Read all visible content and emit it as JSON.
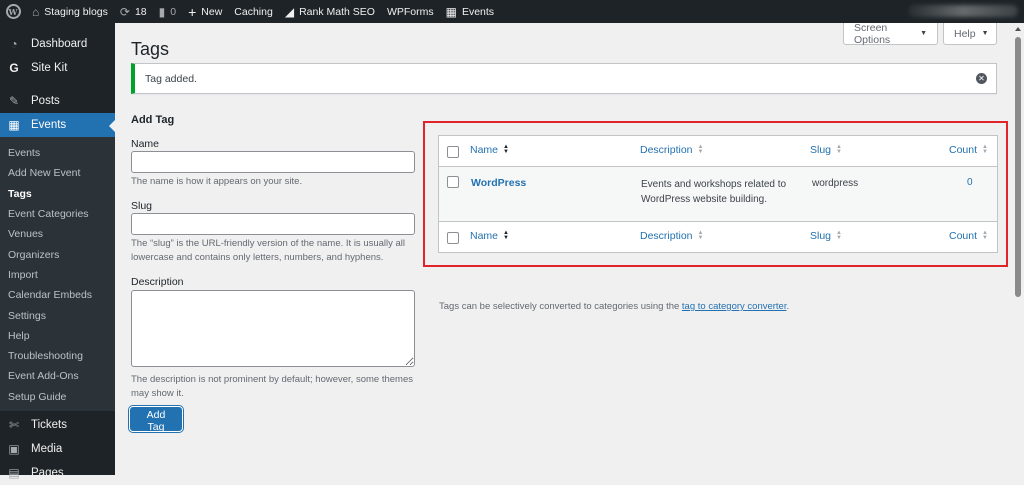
{
  "adminbar": {
    "site_name": "Staging blogs",
    "updates_count": "18",
    "comments_count": "0",
    "new_label": "New",
    "caching_label": "Caching",
    "rankmath_label": "Rank Math SEO",
    "wpforms_label": "WPForms",
    "events_label": "Events"
  },
  "sidebar": {
    "top_items": [
      {
        "label": "Dashboard",
        "icon": "dashboard-icon"
      },
      {
        "label": "Site Kit",
        "icon": "site-kit-icon"
      },
      {
        "label": "Posts",
        "icon": "pin-icon"
      },
      {
        "label": "Events",
        "icon": "calendar-icon"
      }
    ],
    "submenu": [
      "Events",
      "Add New Event",
      "Tags",
      "Event Categories",
      "Venues",
      "Organizers",
      "Import",
      "Calendar Embeds",
      "Settings",
      "Help",
      "Troubleshooting",
      "Event Add-Ons",
      "Setup Guide"
    ],
    "bottom_items": [
      {
        "label": "Tickets",
        "icon": "ticket-icon"
      },
      {
        "label": "Media",
        "icon": "media-icon"
      },
      {
        "label": "Pages",
        "icon": "pages-icon"
      }
    ]
  },
  "header": {
    "title": "Tags",
    "screen_options": "Screen Options",
    "help": "Help"
  },
  "notice": {
    "text": "Tag added."
  },
  "form": {
    "title": "Add Tag",
    "name_label": "Name",
    "name_value": "",
    "name_help": "The name is how it appears on your site.",
    "slug_label": "Slug",
    "slug_value": "",
    "slug_help": "The “slug” is the URL-friendly version of the name. It is usually all lowercase and contains only letters, numbers, and hyphens.",
    "description_label": "Description",
    "description_value": "",
    "description_help": "The description is not prominent by default; however, some themes may show it.",
    "submit_label": "Add Tag"
  },
  "table": {
    "columns": {
      "name": "Name",
      "description": "Description",
      "slug": "Slug",
      "count": "Count"
    },
    "rows": [
      {
        "name": "WordPress",
        "description": "Events and workshops related to WordPress website building.",
        "slug": "wordpress",
        "count": "0"
      }
    ]
  },
  "footer_note": {
    "text": "Tags can be selectively converted to categories using the ",
    "link": "tag to category converter",
    "end": "."
  },
  "colors": {
    "admin_bg": "#1d2327",
    "accent": "#2271b1",
    "notice_success": "#00a32a",
    "highlight_box": "#e0242a"
  }
}
